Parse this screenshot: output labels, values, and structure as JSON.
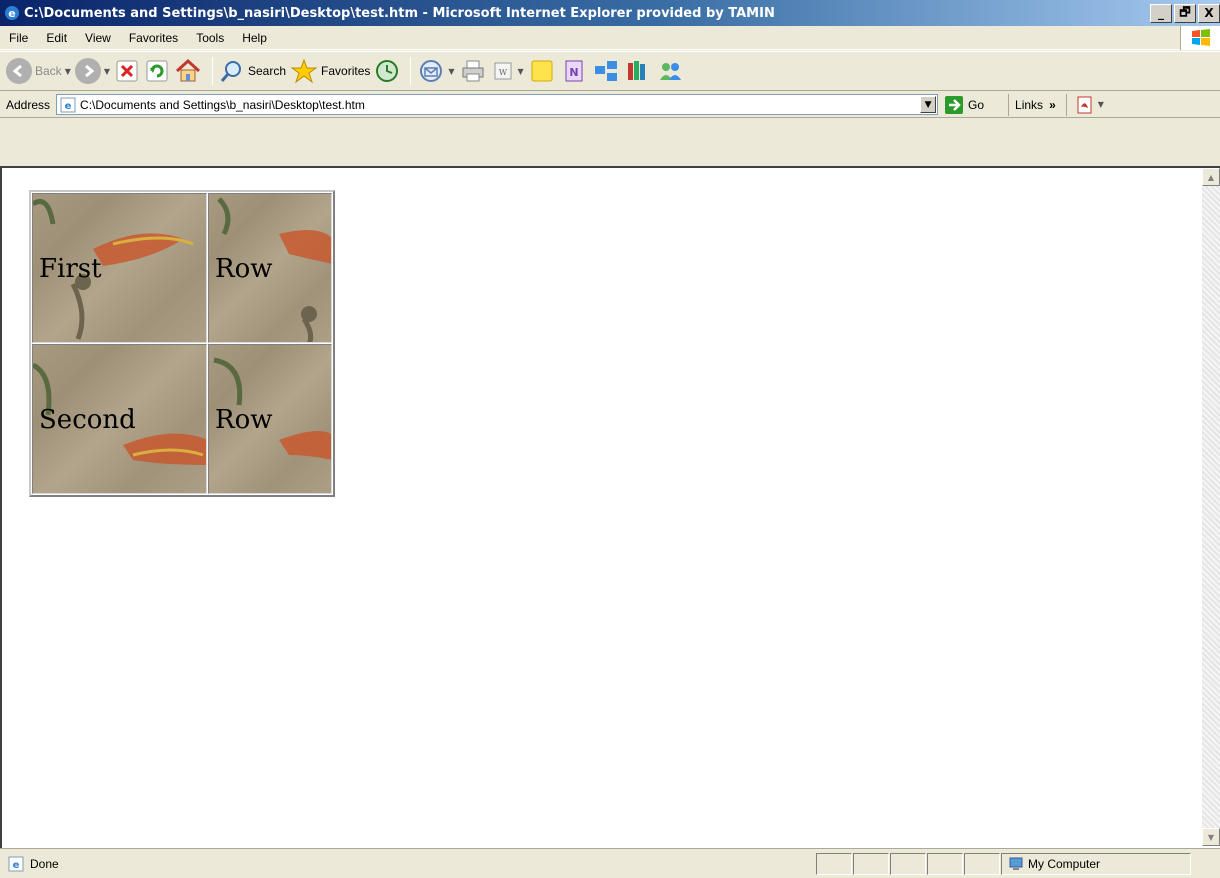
{
  "window": {
    "title": "C:\\Documents and Settings\\b_nasiri\\Desktop\\test.htm - Microsoft Internet Explorer provided by TAMIN",
    "controls": [
      "_",
      "🗗",
      "X"
    ]
  },
  "menu": {
    "items": [
      {
        "label": "File"
      },
      {
        "label": "Edit"
      },
      {
        "label": "View"
      },
      {
        "label": "Favorites"
      },
      {
        "label": "Tools"
      },
      {
        "label": "Help"
      }
    ]
  },
  "toolbar": {
    "back_label": "Back",
    "search_label": "Search",
    "favorites_label": "Favorites"
  },
  "address": {
    "label": "Address",
    "value": "C:\\Documents and Settings\\b_nasiri\\Desktop\\test.htm",
    "go_label": "Go",
    "links_label": "Links",
    "links_chevron": "»"
  },
  "table": {
    "rows": [
      [
        "First",
        "Row"
      ],
      [
        "Second",
        "Row"
      ]
    ]
  },
  "status": {
    "text": "Done",
    "zone": "My Computer"
  },
  "colors": {
    "titlebar_start": "#0a246a",
    "titlebar_end": "#a6caf0",
    "chrome": "#ece9d8"
  }
}
